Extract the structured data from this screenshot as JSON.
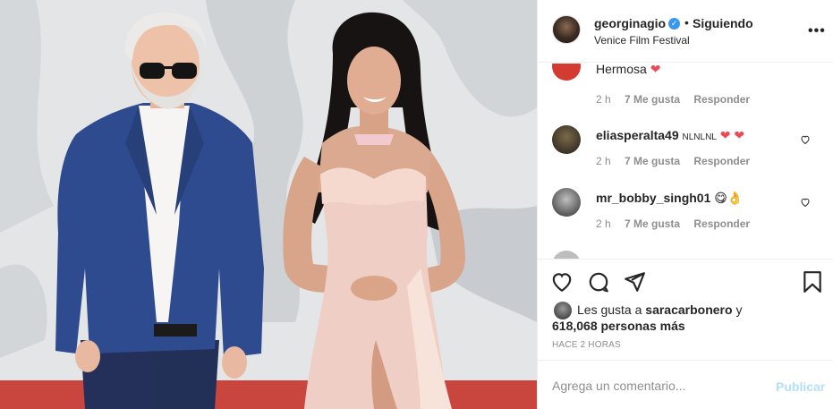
{
  "post": {
    "username": "georginagio",
    "separator": "•",
    "follow_status": "Siguiendo",
    "location": "Venice Film Festival",
    "more_icon": "more-horizontal-icon",
    "verified_icon": "verified-badge-icon"
  },
  "comments": [
    {
      "username": "",
      "text": "Hermosa",
      "emoji": "❤",
      "time": "2 h",
      "likes": "7 Me gusta",
      "reply": "Responder"
    },
    {
      "username": "eliasperalta49",
      "text": "NLNLNL",
      "emoji": "❤ ❤",
      "time": "2 h",
      "likes": "7 Me gusta",
      "reply": "Responder"
    },
    {
      "username": "mr_bobby_singh01",
      "text": "",
      "emoji": "😋👌",
      "time": "2 h",
      "likes": "7 Me gusta",
      "reply": "Responder"
    }
  ],
  "actions": {
    "like_icon": "heart-icon",
    "comment_icon": "comment-icon",
    "share_icon": "share-icon",
    "save_icon": "bookmark-icon"
  },
  "likes": {
    "prefix": "Les gusta a",
    "user": "saracarbonero",
    "conjunction": "y",
    "count_text": "618,068 personas más"
  },
  "time_ago": "HACE 2 HORAS",
  "comment_box": {
    "placeholder": "Agrega un comentario...",
    "publish_label": "Publicar"
  },
  "colors": {
    "link_blue": "#3897f0",
    "publish_disabled": "#b2dffc",
    "muted": "#8e8e8e",
    "heart_red": "#ed4956"
  }
}
